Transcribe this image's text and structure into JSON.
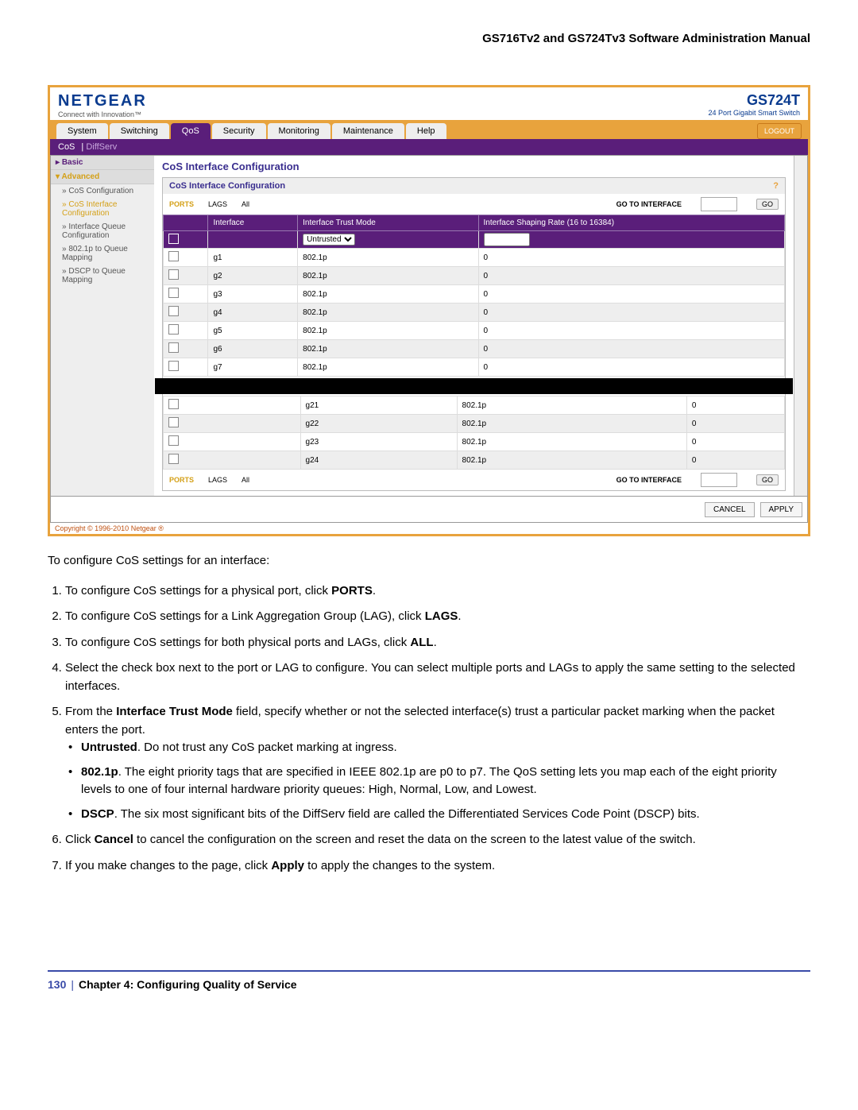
{
  "docHeader": "GS716Tv2 and GS724Tv3 Software Administration Manual",
  "brand": "NETGEAR",
  "tagline": "Connect with Innovation™",
  "model": "GS724T",
  "modelSub": "24 Port Gigabit Smart Switch",
  "tabs": [
    "System",
    "Switching",
    "QoS",
    "Security",
    "Monitoring",
    "Maintenance",
    "Help"
  ],
  "activeTab": "QoS",
  "logout": "LOGOUT",
  "subtabs": [
    "CoS",
    "DiffServ"
  ],
  "activeSub": "CoS",
  "sideBasic": "Basic",
  "sideAdv": "Advanced",
  "sideItems": [
    "CoS Configuration",
    "CoS Interface Configuration",
    "Interface Queue Configuration",
    "802.1p to Queue Mapping",
    "DSCP to Queue Mapping"
  ],
  "sideSel": 1,
  "contentTitle": "CoS Interface Configuration",
  "panelTitle": "CoS Interface Configuration",
  "filterPorts": "PORTS",
  "filterLags": "LAGS",
  "filterAll": "All",
  "goLabel": "GO TO INTERFACE",
  "goBtn": "GO",
  "cols": [
    "",
    "Interface",
    "Interface Trust Mode",
    "Interface Shaping Rate (16 to 16384)"
  ],
  "untrusted": "Untrusted",
  "rows1": [
    {
      "i": "g1",
      "m": "802.1p",
      "r": "0"
    },
    {
      "i": "g2",
      "m": "802.1p",
      "r": "0"
    },
    {
      "i": "g3",
      "m": "802.1p",
      "r": "0"
    },
    {
      "i": "g4",
      "m": "802.1p",
      "r": "0"
    },
    {
      "i": "g5",
      "m": "802.1p",
      "r": "0"
    },
    {
      "i": "g6",
      "m": "802.1p",
      "r": "0"
    },
    {
      "i": "g7",
      "m": "802.1p",
      "r": "0"
    }
  ],
  "rows2": [
    {
      "i": "g21",
      "m": "802.1p",
      "r": "0"
    },
    {
      "i": "g22",
      "m": "802.1p",
      "r": "0"
    },
    {
      "i": "g23",
      "m": "802.1p",
      "r": "0"
    },
    {
      "i": "g24",
      "m": "802.1p",
      "r": "0"
    }
  ],
  "cancel": "CANCEL",
  "apply": "APPLY",
  "copyright": "Copyright © 1996-2010 Netgear ®",
  "intro": "To configure CoS settings for an interface:",
  "s1a": "To configure CoS settings for a physical port, click ",
  "s1b": "PORTS",
  "s1c": ".",
  "s2a": "To configure CoS settings for a Link Aggregation Group (LAG), click ",
  "s2b": "LAGS",
  "s2c": ".",
  "s3a": "To configure CoS settings for both physical ports and LAGs, click ",
  "s3b": "ALL",
  "s3c": ".",
  "s4": "Select the check box next to the port or LAG to configure. You can select multiple ports and LAGs to apply the same setting to the selected interfaces.",
  "s5a": "From the ",
  "s5b": "Interface Trust Mode",
  "s5c": " field, specify whether or not the selected interface(s) trust a particular packet marking when the packet enters the port.",
  "b1a": "Untrusted",
  "b1b": ". Do not trust any CoS packet marking at ingress.",
  "b2a": "802.1p",
  "b2b": ". The eight priority tags that are specified in IEEE 802.1p are p0 to p7. The QoS setting lets you map each of the eight priority levels to one of four internal hardware priority queues: High, Normal, Low, and Lowest.",
  "b3a": "DSCP",
  "b3b": ". The six most significant bits of the DiffServ field are called the Differentiated Services Code Point (DSCP) bits.",
  "s6a": "Click ",
  "s6b": "Cancel",
  "s6c": " to cancel the configuration on the screen and reset the data on the screen to the latest value of the switch.",
  "s7a": "If you make changes to the page, click ",
  "s7b": "Apply",
  "s7c": " to apply the changes to the system.",
  "pageNum": "130",
  "chapter": "Chapter 4:  Configuring Quality of Service"
}
